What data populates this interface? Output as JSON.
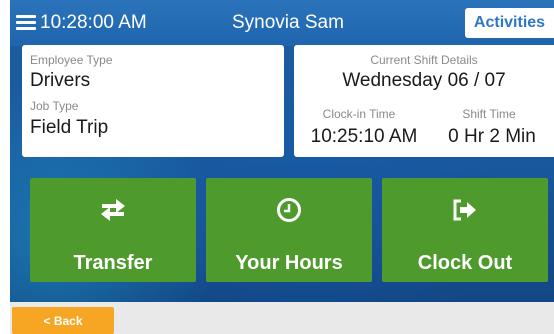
{
  "header": {
    "time": "10:28:00 AM",
    "user_name": "Synovia Sam",
    "activities_label": "Activities"
  },
  "employee_card": {
    "employee_type_label": "Employee Type",
    "employee_type_value": "Drivers",
    "job_type_label": "Job Type",
    "job_type_value": "Field Trip"
  },
  "shift_card": {
    "title": "Current Shift Details",
    "date": "Wednesday 06 / 07",
    "clock_in_label": "Clock-in Time",
    "clock_in_value": "10:25:10 AM",
    "shift_time_label": "Shift Time",
    "shift_time_value": "0 Hr 2 Min"
  },
  "tiles": [
    {
      "label": "Transfer",
      "icon": "transfer-arrows-icon"
    },
    {
      "label": "Your Hours",
      "icon": "clock-icon"
    },
    {
      "label": "Clock Out",
      "icon": "sign-out-icon"
    }
  ],
  "footer": {
    "back_label": "< Back"
  },
  "colors": {
    "header_blue": "#1f65ad",
    "tile_green": "#4e9a2c",
    "back_orange": "#f6a623",
    "activities_text": "#2f78c4"
  }
}
